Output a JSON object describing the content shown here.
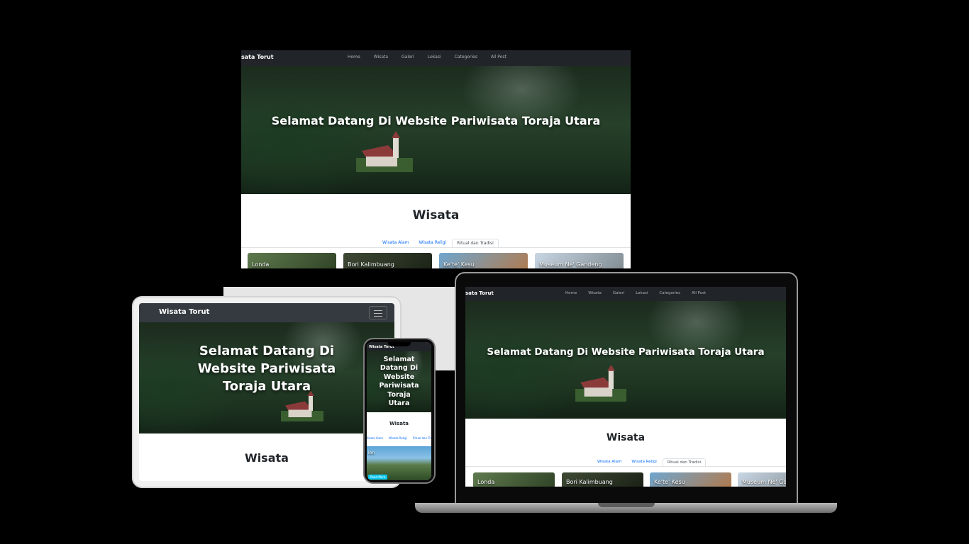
{
  "site": {
    "brand": "Wisata Torut",
    "brand_cut": "sata Torut",
    "nav": [
      "Home",
      "Wisata",
      "Galeri",
      "Lokasi",
      "Categories",
      "All Post"
    ],
    "hero_title": "Selamat Datang Di Website Pariwisata Toraja Utara",
    "section_title": "Wisata",
    "tabs": [
      "Wisata Alam",
      "Wisata Religi",
      "Ritual dan Tradisi"
    ],
    "tabs_phone": [
      "Wisata Alam",
      "Wisata Religi",
      "Ritual dan Tradisi"
    ],
    "cards": [
      "Londa",
      "Bori Kalimbuang",
      "Ke'te' Kesu",
      "Museum Ne' Gandeng"
    ],
    "phone_card": "lon",
    "phone_button": "Read More",
    "icons": [
      "hamburger-icon"
    ]
  },
  "colors": {
    "nav_bg": "#212529",
    "link": "#0d6efd",
    "background": "#000000"
  }
}
